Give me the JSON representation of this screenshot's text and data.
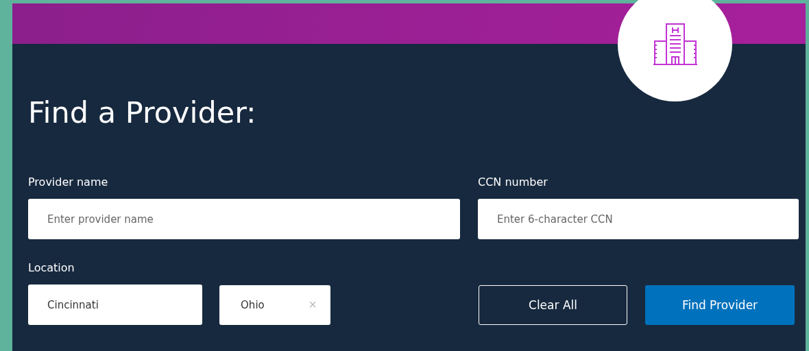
{
  "title": "Find a Provider:",
  "provider_name": {
    "label": "Provider name",
    "placeholder": "Enter provider name"
  },
  "ccn_number": {
    "label": "CCN number",
    "placeholder": "Enter 6-character CCN"
  },
  "location": {
    "label": "Location",
    "city": "Cincinnati",
    "state": "Ohio",
    "clear": "×"
  },
  "buttons": [
    {
      "label": "Clear All",
      "kind": "outline"
    },
    {
      "label": "Find Provider",
      "kind": "primary"
    }
  ]
}
